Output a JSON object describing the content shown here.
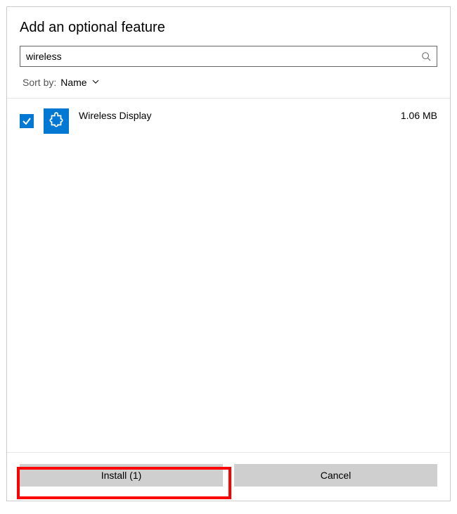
{
  "dialog": {
    "title": "Add an optional feature"
  },
  "search": {
    "value": "wireless"
  },
  "sort": {
    "label": "Sort by:",
    "value": "Name"
  },
  "features": [
    {
      "name": "Wireless Display",
      "size": "1.06 MB",
      "checked": true
    }
  ],
  "footer": {
    "install_label": "Install (1)",
    "cancel_label": "Cancel"
  }
}
